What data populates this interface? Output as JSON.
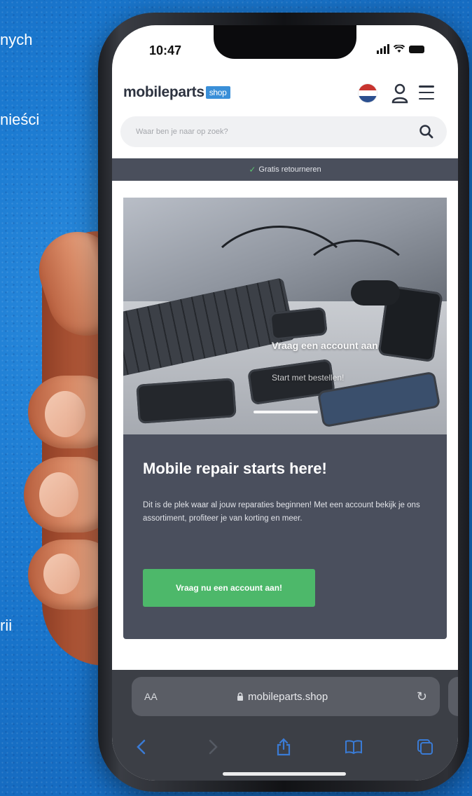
{
  "side_text": [
    "nych",
    "nieści",
    "rii"
  ],
  "status": {
    "time": "10:47"
  },
  "header": {
    "logo_text": "mobileparts",
    "logo_badge": "shop"
  },
  "search": {
    "placeholder": "Waar ben je naar op zoek?"
  },
  "banner": {
    "text": "Gratis retourneren"
  },
  "hero": {
    "line1": "Vraag een account aan",
    "line2": "Start met bestellen!"
  },
  "card": {
    "title": "Mobile repair starts here!",
    "text": "Dit is de plek waar al jouw reparaties beginnen! Met een account bekijk je ons assortiment, profiteer je van korting en meer.",
    "button_label": "Vraag nu een account aan!"
  },
  "browser": {
    "aa": "AA",
    "url": "mobileparts.shop"
  },
  "colors": {
    "background": "#1a78cf",
    "logo_badge": "#3a8fd8",
    "banner": "#4a4f5c",
    "card": "#4a4f5d",
    "cta": "#4db86a",
    "check": "#5bc46f",
    "toolbar_icons": "#3a7bd5"
  },
  "icons": [
    "flag-nl-icon",
    "user-icon",
    "menu-icon",
    "search-icon",
    "check-icon",
    "lock-icon",
    "reload-icon",
    "back-icon",
    "forward-icon",
    "share-icon",
    "bookmarks-icon",
    "tabs-icon"
  ]
}
